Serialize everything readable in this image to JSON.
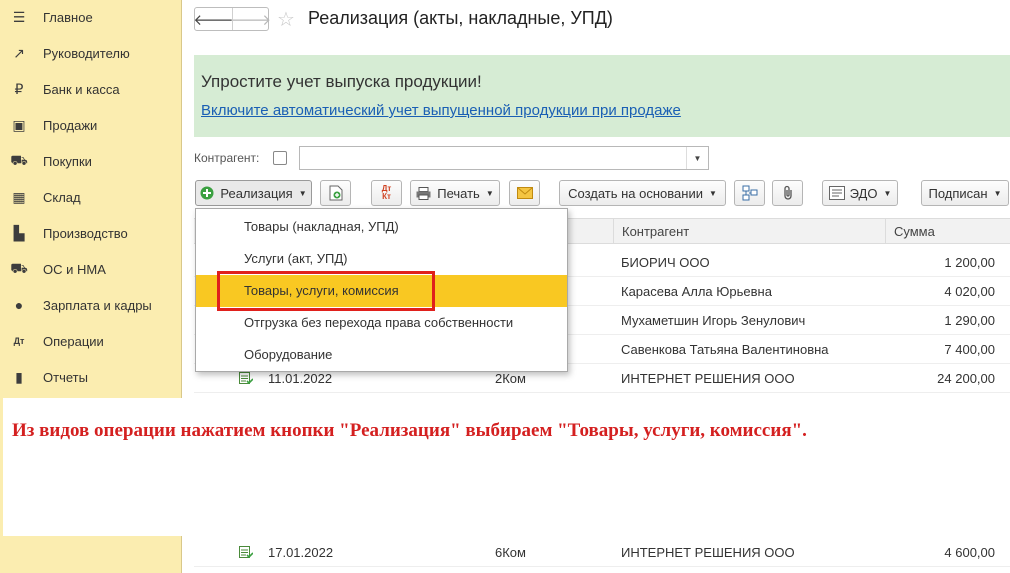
{
  "sidebar": {
    "items": [
      {
        "label": "Главное",
        "icon": "menu-icon",
        "glyph": "☰"
      },
      {
        "label": "Руководителю",
        "icon": "trend-icon",
        "glyph": "↗"
      },
      {
        "label": "Банк и касса",
        "icon": "ruble-icon",
        "glyph": "₽"
      },
      {
        "label": "Продажи",
        "icon": "bag-icon",
        "glyph": "▣"
      },
      {
        "label": "Покупки",
        "icon": "cart-icon",
        "glyph": "⛟"
      },
      {
        "label": "Склад",
        "icon": "warehouse-icon",
        "glyph": "▦"
      },
      {
        "label": "Производство",
        "icon": "factory-icon",
        "glyph": "▙"
      },
      {
        "label": "ОС и НМА",
        "icon": "truck-icon",
        "glyph": "⛟"
      },
      {
        "label": "Зарплата и кадры",
        "icon": "person-icon",
        "glyph": "●"
      },
      {
        "label": "Операции",
        "icon": "dt-kt-icon",
        "glyph": "Дт"
      },
      {
        "label": "Отчеты",
        "icon": "bar-chart-icon",
        "glyph": "▮"
      }
    ]
  },
  "header": {
    "back_glyph": "🡐",
    "forward_glyph": "🡒",
    "star_glyph": "☆",
    "title": "Реализация (акты, накладные, УПД)"
  },
  "banner": {
    "title": "Упростите учет выпуска продукции!",
    "link": "Включите автоматический учет выпущенной продукции при продаже"
  },
  "filter": {
    "label": "Контрагент:",
    "value": "",
    "dropdown_glyph": "▼"
  },
  "toolbar": {
    "realization_label": "Реализация",
    "print_label": "Печать",
    "create_based_label": "Создать на основании",
    "edo_label": "ЭДО",
    "signed_label": "Подписан",
    "caret": "▼"
  },
  "grid": {
    "columns": [
      "Контрагент",
      "Сумма"
    ],
    "rows": [
      {
        "date": "",
        "number": "",
        "counterparty": "БИОРИЧ ООО",
        "sum": "1 200,00"
      },
      {
        "date": "",
        "number": "",
        "counterparty": "Карасева Алла Юрьевна",
        "sum": "4 020,00"
      },
      {
        "date": "",
        "number": "",
        "counterparty": "Мухаметшин Игорь Зенулович",
        "sum": "1 290,00"
      },
      {
        "date": "",
        "number": "",
        "counterparty": "Савенкова Татьяна Валентиновна",
        "sum": "7 400,00"
      },
      {
        "date": "11.01.2022",
        "number": "2Ком",
        "counterparty": "ИНТЕРНЕТ РЕШЕНИЯ ООО",
        "sum": "24 200,00"
      },
      {
        "date": "17.01.2022",
        "number": "6Ком",
        "counterparty": "ИНТЕРНЕТ РЕШЕНИЯ ООО",
        "sum": "4 600,00"
      }
    ]
  },
  "menu": {
    "items": [
      {
        "label": "Товары (накладная, УПД)"
      },
      {
        "label": "Услуги (акт, УПД)"
      },
      {
        "label": "Товары, услуги, комиссия"
      },
      {
        "label": "Отгрузка без перехода права собственности"
      },
      {
        "label": "Оборудование"
      }
    ],
    "selected_index": 2
  },
  "note": {
    "text": "Из видов операции нажатием кнопки \"Реализация\" выбираем \"Товары, услуги, комиссия\"."
  },
  "colors": {
    "sidebar_bg": "#fbedb0",
    "banner_bg": "#d6ecd4",
    "selected_bg": "#f9c822",
    "highlight": "#e0201c",
    "note_text": "#d42020",
    "link": "#1a5fb4"
  }
}
